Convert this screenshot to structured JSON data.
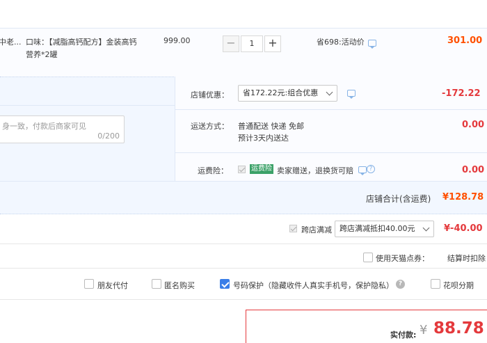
{
  "product": {
    "name_fragment": "中老...",
    "flavor": "口味：【减脂高钙配方】金装高钙营养*2罐",
    "flavor_line1": "口味：【减脂高钙配方】金装高钙",
    "flavor_line2": "营养*2罐",
    "unit_price": "999.00",
    "quantity": "1",
    "quantity_minus": "−",
    "quantity_plus": "+",
    "promo": "省698:活动价",
    "subtotal": "301.00"
  },
  "shop": {
    "message_placeholder": "与商家协商一致，付款后商家可见",
    "message_placeholder_visible": "身一致，付款后商家可见",
    "message_count": "0/200",
    "discount_label": "店铺优惠：",
    "discount_select": "省172.22元:组合优惠",
    "discount_amount": "-172.22",
    "shipping_label": "运送方式：",
    "shipping_method": "普通配送 快递 免邮",
    "shipping_eta": "预计3天内送达",
    "shipping_amount": "0.00",
    "insurance_label": "运费险：",
    "insurance_tag": "运费险",
    "insurance_text": "卖家赠送，退换货可赔",
    "insurance_amount": "0.00",
    "total_label": "店铺合计(含运费)",
    "total_amount": "¥128.78"
  },
  "cross_store": {
    "label": "跨店满减",
    "select": "跨店满减抵扣40.00元",
    "amount": "¥-40.00"
  },
  "tmall_points": {
    "label": "使用天猫点券：",
    "settle_text": "结算时扣除"
  },
  "options": {
    "friend_pay": "朋友代付",
    "anonymous": "匿名购买",
    "number_protect": "号码保护（隐藏收件人真实手机号，保护隐私）",
    "huabei": "花呗分期"
  },
  "payment": {
    "label": "实付款:",
    "currency": "¥",
    "amount": "88.78"
  },
  "colors": {
    "price_red": "#e4393c",
    "orange": "#ff5000",
    "accent_blue": "#3a7ee8"
  }
}
